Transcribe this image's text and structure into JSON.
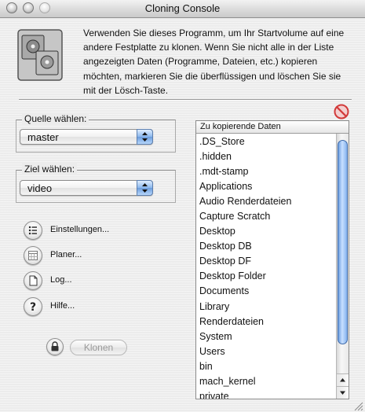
{
  "window": {
    "title": "Cloning Console"
  },
  "intro": {
    "text": "Verwenden Sie dieses Programm, um Ihr Startvolume auf eine andere Festplatte zu klonen. Wenn Sie nicht alle in der Liste angezeigten Daten (Programme, Dateien, etc.) kopieren möchten, markieren Sie die überflüssigen und löschen Sie sie mit der Lösch-Taste."
  },
  "source": {
    "label": "Quelle wählen:",
    "value": "master"
  },
  "target": {
    "label": "Ziel wählen:",
    "value": "video"
  },
  "actions": {
    "settings": "Einstellungen...",
    "scheduler": "Planer...",
    "log": "Log...",
    "help": "Hilfe..."
  },
  "clone_button": {
    "label": "Klonen",
    "enabled": false
  },
  "list": {
    "header": "Zu kopierende Daten",
    "items": [
      ".DS_Store",
      ".hidden",
      ".mdt-stamp",
      "Applications",
      "Audio Renderdateien",
      "Capture Scratch",
      "Desktop",
      "Desktop DB",
      "Desktop DF",
      "Desktop Folder",
      "Documents",
      "Library",
      "Renderdateien",
      "System",
      "Users",
      "bin",
      "mach_kernel",
      "private"
    ]
  },
  "icons": {
    "app": "dual-hard-drive-icon",
    "settings": "list-icon",
    "scheduler": "calendar-icon",
    "log": "document-icon",
    "help": "question-icon",
    "lock": "lock-icon",
    "delete": "no-entry-icon"
  },
  "colors": {
    "accent": "#6a9cdc",
    "delete": "#d23a3a"
  }
}
